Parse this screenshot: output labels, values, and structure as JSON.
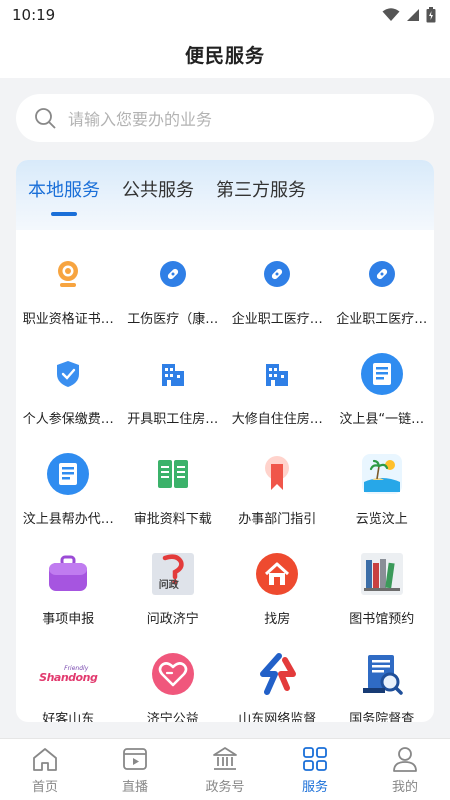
{
  "status_bar": {
    "time": "10:19"
  },
  "header": {
    "title": "便民服务"
  },
  "search": {
    "placeholder": "请输入您要办的业务"
  },
  "tabs": [
    {
      "label": "本地服务",
      "active": true
    },
    {
      "label": "公共服务",
      "active": false
    },
    {
      "label": "第三方服务",
      "active": false
    }
  ],
  "services": [
    {
      "label": "职业资格证书…",
      "icon": "webcam-icon"
    },
    {
      "label": "工伤医疗（康…",
      "icon": "medical-icon"
    },
    {
      "label": "企业职工医疗…",
      "icon": "medical-icon"
    },
    {
      "label": "企业职工医疗…",
      "icon": "medical-icon"
    },
    {
      "label": "个人参保缴费…",
      "icon": "insurance-shield-icon"
    },
    {
      "label": "开具职工住房…",
      "icon": "building-icon"
    },
    {
      "label": "大修自住住房…",
      "icon": "building-icon"
    },
    {
      "label": "汶上县“一链…",
      "icon": "document-icon"
    },
    {
      "label": "汶上县帮办代…",
      "icon": "document-icon"
    },
    {
      "label": "审批资料下载",
      "icon": "book-icon"
    },
    {
      "label": "办事部门指引",
      "icon": "ribbon-icon"
    },
    {
      "label": "云览汶上",
      "icon": "island-icon"
    },
    {
      "label": "事项申报",
      "icon": "briefcase-icon"
    },
    {
      "label": "问政济宁",
      "icon": "wenzheng-logo-icon"
    },
    {
      "label": "找房",
      "icon": "house-icon"
    },
    {
      "label": "图书馆预约",
      "icon": "bookshelf-icon"
    },
    {
      "label": "好客山东",
      "icon": "shandong-logo-icon"
    },
    {
      "label": "济宁公益",
      "icon": "heart-icon"
    },
    {
      "label": "山东网络监督",
      "icon": "network-logo-icon"
    },
    {
      "label": "国务院督查",
      "icon": "inspection-icon"
    }
  ],
  "logo_text": {
    "friendly": "Friendly",
    "shandong": "Shandong",
    "wenzheng": "问政"
  },
  "bottom_nav": [
    {
      "label": "首页",
      "icon": "home-icon",
      "active": false
    },
    {
      "label": "直播",
      "icon": "live-video-icon",
      "active": false
    },
    {
      "label": "政务号",
      "icon": "government-icon",
      "active": false
    },
    {
      "label": "服务",
      "icon": "services-grid-icon",
      "active": true
    },
    {
      "label": "我的",
      "icon": "profile-icon",
      "active": false
    }
  ],
  "colors": {
    "accent": "#1a6fd8",
    "inactive": "#888888"
  }
}
